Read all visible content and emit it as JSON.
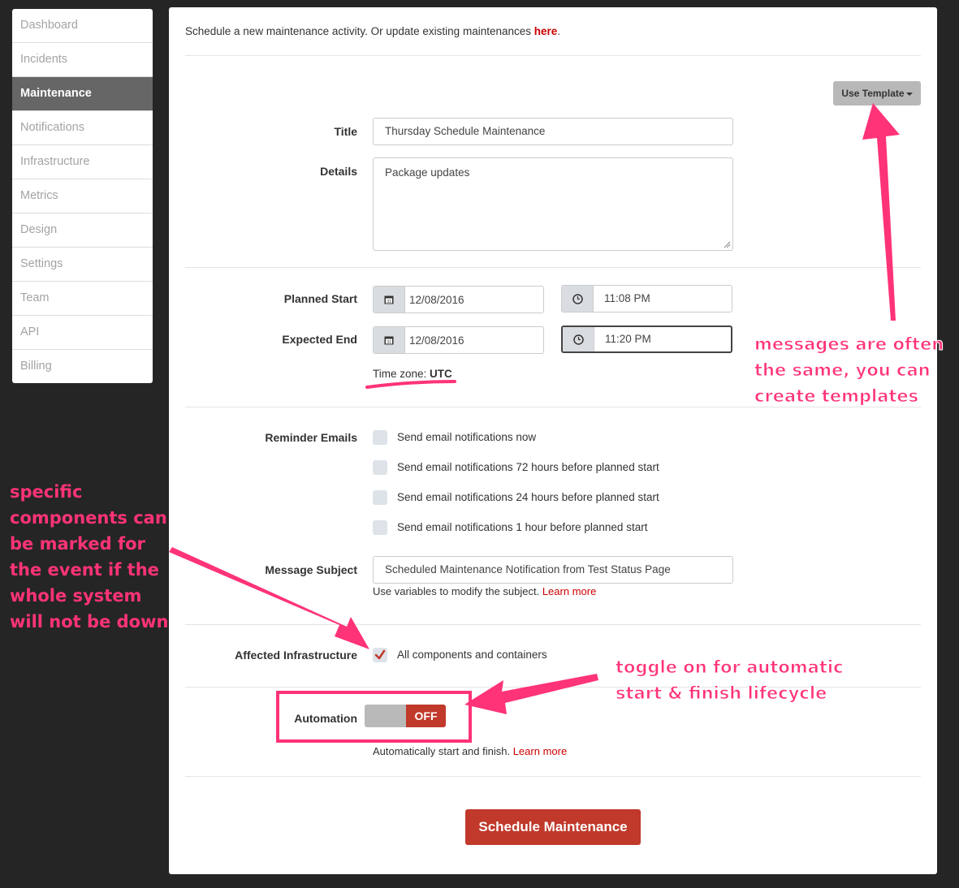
{
  "sidebar": {
    "items": [
      {
        "label": "Dashboard",
        "active": false
      },
      {
        "label": "Incidents",
        "active": false
      },
      {
        "label": "Maintenance",
        "active": true
      },
      {
        "label": "Notifications",
        "active": false
      },
      {
        "label": "Infrastructure",
        "active": false
      },
      {
        "label": "Metrics",
        "active": false
      },
      {
        "label": "Design",
        "active": false
      },
      {
        "label": "Settings",
        "active": false
      },
      {
        "label": "Team",
        "active": false
      },
      {
        "label": "API",
        "active": false
      },
      {
        "label": "Billing",
        "active": false
      }
    ]
  },
  "intro": {
    "text": "Schedule a new maintenance activity. Or update existing maintenances ",
    "link": "here",
    "end": "."
  },
  "template_button": {
    "label": "Use Template"
  },
  "form": {
    "title_label": "Title",
    "title_value": "Thursday Schedule Maintenance",
    "details_label": "Details",
    "details_value": "Package updates",
    "planned_start_label": "Planned Start",
    "planned_start_date": "12/08/2016",
    "planned_start_time": "11:08 PM",
    "expected_end_label": "Expected End",
    "expected_end_date": "12/08/2016",
    "expected_end_time": "11:20 PM",
    "timezone_prefix": "Time zone: ",
    "timezone_value": "UTC",
    "reminder_label": "Reminder Emails",
    "reminders": [
      {
        "label": "Send email notifications now",
        "checked": false
      },
      {
        "label": "Send email notifications 72 hours before planned start",
        "checked": false
      },
      {
        "label": "Send email notifications 24 hours before planned start",
        "checked": false
      },
      {
        "label": "Send email notifications 1 hour before planned start",
        "checked": false
      }
    ],
    "subject_label": "Message Subject",
    "subject_value": "Scheduled Maintenance Notification from Test Status Page",
    "subject_help": "Use variables to modify the subject. ",
    "subject_help_link": "Learn more",
    "affected_label": "Affected Infrastructure",
    "affected_option": "All components and containers",
    "affected_checked": true,
    "automation_label": "Automation",
    "automation_state": "OFF",
    "automation_help": "Automatically start and finish. ",
    "automation_help_link": "Learn more",
    "submit_label": "Schedule Maintenance"
  },
  "annotations": {
    "template_note": [
      "messages are often",
      "the same, you can",
      "create templates"
    ],
    "components_note": [
      "specific",
      "components can",
      "be marked for",
      "the event if the",
      "whole system",
      "will not be down"
    ],
    "automation_note": [
      "toggle on for automatic",
      "start & finish lifecycle"
    ]
  },
  "colors": {
    "accent": "#c0392b",
    "annotation": "#ff3377",
    "link": "#cc0000"
  }
}
